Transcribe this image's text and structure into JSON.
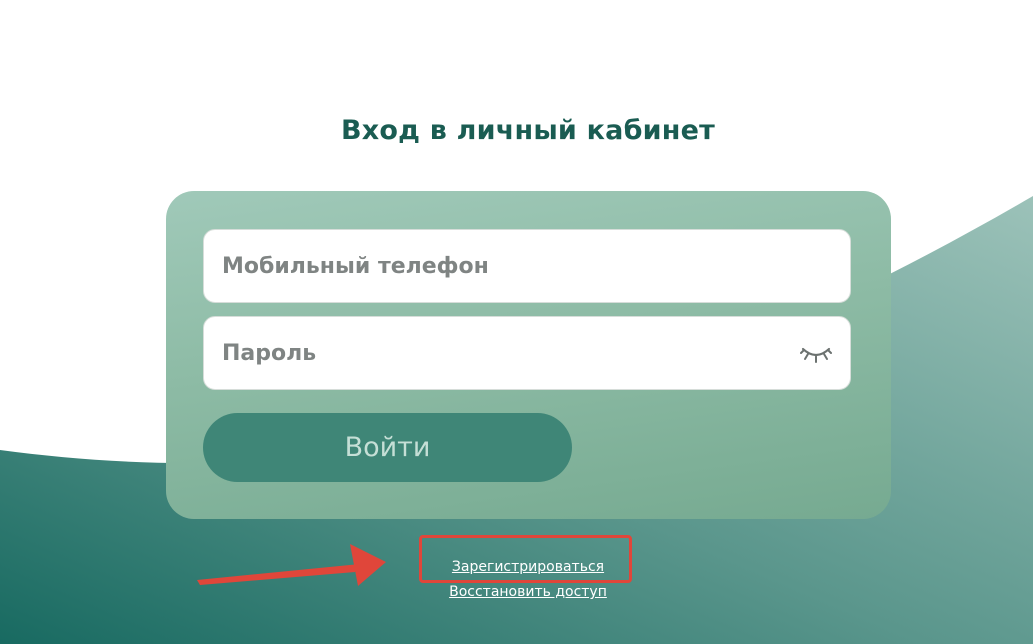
{
  "page": {
    "title": "Вход в личный кабинет"
  },
  "form": {
    "phone_placeholder": "Мобильный телефон",
    "password_placeholder": "Пароль",
    "login_label": "Войти"
  },
  "links": {
    "register": "Зарегистрироваться",
    "restore": "Восстановить доступ"
  },
  "icons": {
    "password_toggle": "eye-closed-icon"
  },
  "colors": {
    "title": "#1a5c52",
    "card": "#8dbba5",
    "button": "#3f8677",
    "wave_dark": "#186a61",
    "wave_light": "#8eb7ae",
    "annotation": "#e0463a"
  }
}
